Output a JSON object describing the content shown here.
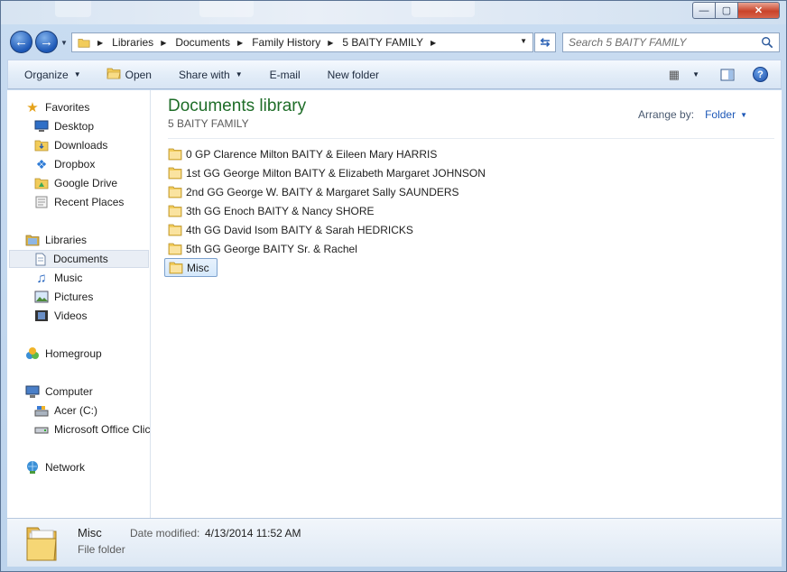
{
  "window": {
    "controls": {
      "minimize": "—",
      "maximize": "▢",
      "close": "✕"
    }
  },
  "address": {
    "crumbs": [
      "Libraries",
      "Documents",
      "Family History",
      "5 BAITY FAMILY"
    ],
    "search_placeholder": "Search 5 BAITY FAMILY"
  },
  "toolbar": {
    "organize": "Organize",
    "open": "Open",
    "share_with": "Share with",
    "email": "E-mail",
    "new_folder": "New folder"
  },
  "nav": {
    "favorites": "Favorites",
    "desktop": "Desktop",
    "downloads": "Downloads",
    "dropbox": "Dropbox",
    "google_drive": "Google Drive",
    "recent_places": "Recent Places",
    "libraries": "Libraries",
    "documents": "Documents",
    "music": "Music",
    "pictures": "Pictures",
    "videos": "Videos",
    "homegroup": "Homegroup",
    "computer": "Computer",
    "acer": "Acer (C:)",
    "office": "Microsoft Office Click-to-Run",
    "network": "Network"
  },
  "library": {
    "title": "Documents library",
    "subtitle": "5 BAITY FAMILY",
    "arrange_label": "Arrange by:",
    "arrange_value": "Folder"
  },
  "files": [
    "0 GP Clarence Milton BAITY & Eileen Mary HARRIS",
    "1st GG George Milton BAITY & Elizabeth Margaret JOHNSON",
    "2nd GG George W. BAITY & Margaret Sally SAUNDERS",
    "3th GG Enoch BAITY & Nancy SHORE",
    "4th GG David Isom BAITY & Sarah HEDRICKS",
    "5th GG George BAITY Sr. & Rachel",
    "Misc"
  ],
  "details": {
    "name": "Misc",
    "type": "File folder",
    "modified_label": "Date modified:",
    "modified_value": "4/13/2014 11:52 AM"
  },
  "colors": {
    "library_title": "#1e6d28",
    "link_blue": "#1d58b7",
    "folder_yellow": "#f2cc5a",
    "selection_border": "#7da2ce"
  }
}
